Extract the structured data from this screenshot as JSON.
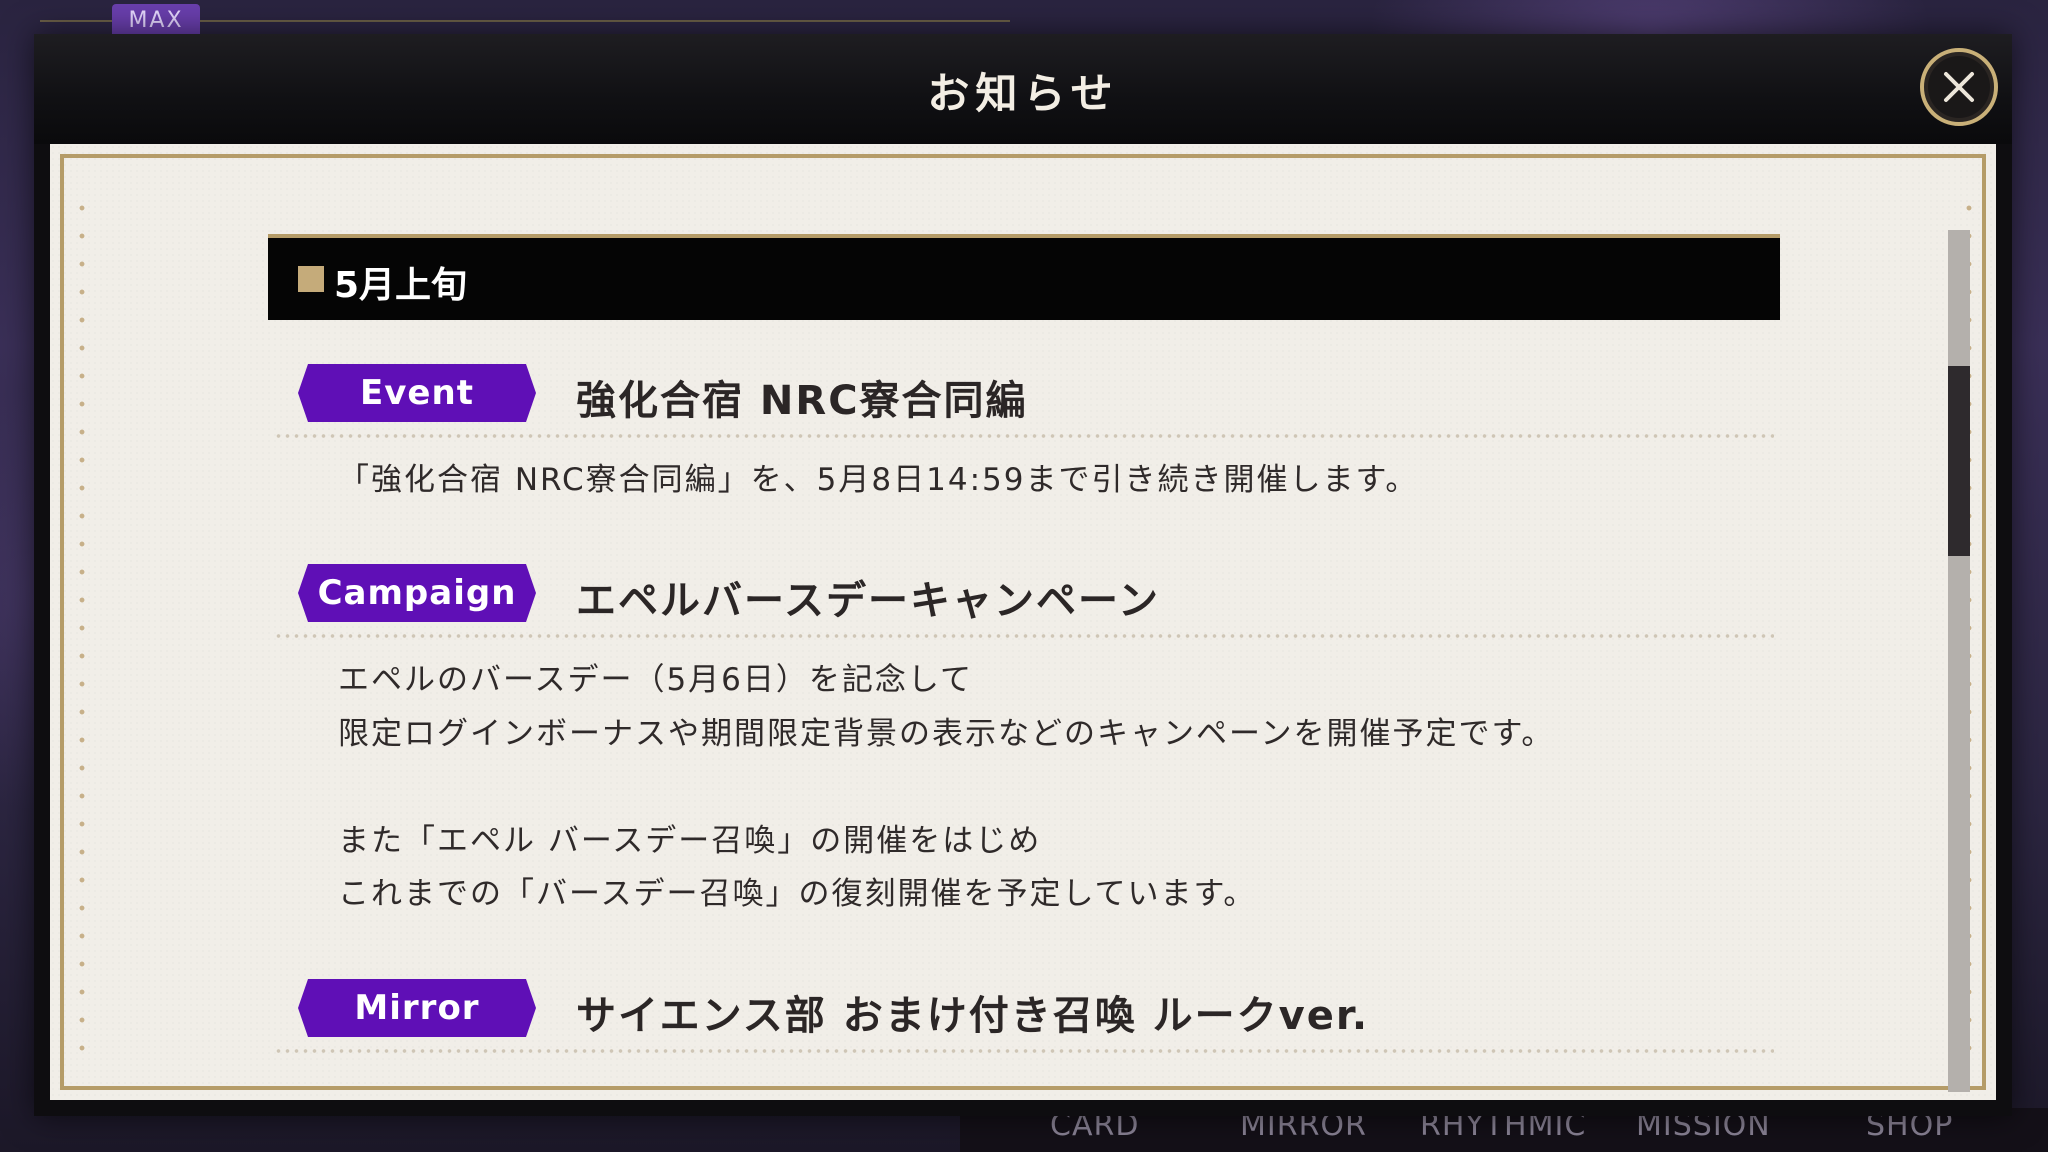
{
  "hud": {
    "max_badge": "MAX"
  },
  "bottom_nav": [
    "CARD",
    "MIRROR",
    "RHYTHMIC",
    "MISSION",
    "SHOP"
  ],
  "dialog": {
    "title": "お知らせ",
    "close_icon": "close-icon"
  },
  "section": {
    "label": "5月上旬"
  },
  "items": [
    {
      "tag": "Event",
      "title": "強化合宿 NRC寮合同編",
      "body": [
        "「強化合宿 NRC寮合同編」を、5月8日14:59まで引き続き開催します。"
      ]
    },
    {
      "tag": "Campaign",
      "title": "エペルバースデーキャンペーン",
      "body": [
        "エペルのバースデー（5月6日）を記念して",
        "限定ログインボーナスや期間限定背景の表示などのキャンペーンを開催予定です。",
        "",
        "また「エペル バースデー召喚」の開催をはじめ",
        "これまでの「バースデー召喚」の復刻開催を予定しています。"
      ]
    },
    {
      "tag": "Mirror",
      "title": "サイエンス部 おまけ付き召喚 ルークver.",
      "body": []
    }
  ],
  "colors": {
    "tag_purple": "#5f0fb6",
    "frame_gold": "#b59c68",
    "paper": "#f1eee8"
  },
  "scroll": {
    "position_fraction": 0.2
  }
}
